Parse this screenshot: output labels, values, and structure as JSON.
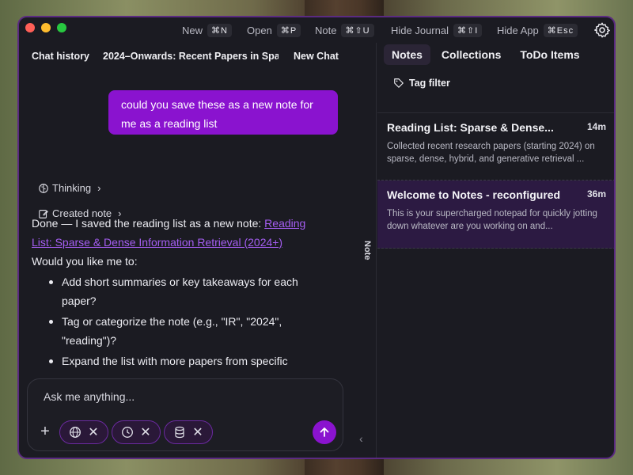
{
  "titlebar": {
    "shortcuts": [
      {
        "label": "New",
        "keys": "⌘N"
      },
      {
        "label": "Open",
        "keys": "⌘P"
      },
      {
        "label": "Note",
        "keys": "⌘⇧U"
      },
      {
        "label": "Hide Journal",
        "keys": "⌘⇧I"
      },
      {
        "label": "Hide App",
        "keys": "⌘Esc"
      }
    ]
  },
  "chat": {
    "tabs": [
      "Chat history",
      "2024–Onwards: Recent Papers in Spar",
      "New Chat"
    ],
    "user_message": "could you save these as a new note for me as a reading list",
    "thinking_label": "Thinking",
    "created_note_label": "Created note",
    "reply_intro": "Done — I saved the reading list as a new note: ",
    "reply_link": "Reading List: Sparse & Dense Information Retrieval (2024+)",
    "reply_question": "Would you like me to:",
    "reply_options": [
      "Add short summaries or key takeaways for each paper?",
      "Tag or categorize the note (e.g., \"IR\", \"2024\", \"reading\")?",
      "Expand the list with more papers from specific"
    ],
    "composer_placeholder": "Ask me anything..."
  },
  "rail": {
    "label": "Note"
  },
  "notes_panel": {
    "tabs": [
      "Notes",
      "Collections",
      "ToDo Items"
    ],
    "active_tab": "Notes",
    "tag_filter_label": "Tag filter",
    "notes": [
      {
        "title": "Reading List: Sparse & Dense...",
        "time": "14m",
        "preview": "Collected recent research papers (starting 2024) on sparse, dense, hybrid, and generative retrieval ..."
      },
      {
        "title": "Welcome to Notes - reconfigured",
        "time": "36m",
        "preview": "This is your supercharged notepad for quickly jotting down whatever are you working on and..."
      }
    ]
  },
  "colors": {
    "accent": "#8a13cf",
    "window_bg": "#1b1b22",
    "selected_note_bg": "#2c1a42",
    "link": "#a55ef2"
  }
}
